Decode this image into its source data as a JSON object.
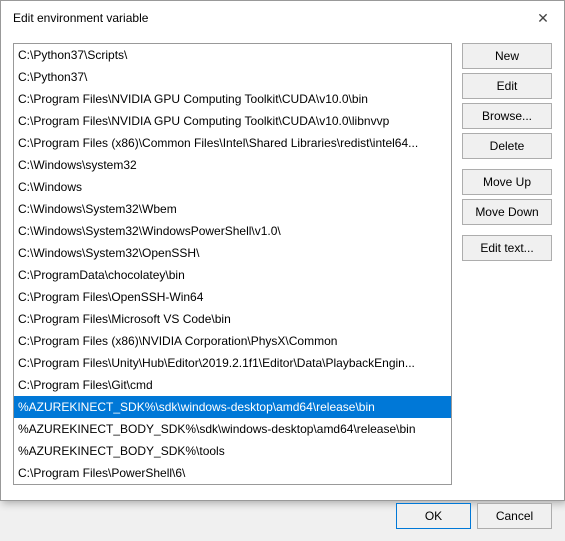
{
  "dialog": {
    "title": "Edit environment variable",
    "close_label": "✕"
  },
  "list": {
    "items": [
      {
        "text": "C:\\Python37\\Scripts\\",
        "selected": false
      },
      {
        "text": "C:\\Python37\\",
        "selected": false
      },
      {
        "text": "C:\\Program Files\\NVIDIA GPU Computing Toolkit\\CUDA\\v10.0\\bin",
        "selected": false
      },
      {
        "text": "C:\\Program Files\\NVIDIA GPU Computing Toolkit\\CUDA\\v10.0\\libnvvp",
        "selected": false
      },
      {
        "text": "C:\\Program Files (x86)\\Common Files\\Intel\\Shared Libraries\\redist\\intel64...",
        "selected": false
      },
      {
        "text": "C:\\Windows\\system32",
        "selected": false
      },
      {
        "text": "C:\\Windows",
        "selected": false
      },
      {
        "text": "C:\\Windows\\System32\\Wbem",
        "selected": false
      },
      {
        "text": "C:\\Windows\\System32\\WindowsPowerShell\\v1.0\\",
        "selected": false
      },
      {
        "text": "C:\\Windows\\System32\\OpenSSH\\",
        "selected": false
      },
      {
        "text": "C:\\ProgramData\\chocolatey\\bin",
        "selected": false
      },
      {
        "text": "C:\\Program Files\\OpenSSH-Win64",
        "selected": false
      },
      {
        "text": "C:\\Program Files\\Microsoft VS Code\\bin",
        "selected": false
      },
      {
        "text": "C:\\Program Files (x86)\\NVIDIA Corporation\\PhysX\\Common",
        "selected": false
      },
      {
        "text": "C:\\Program Files\\Unity\\Hub\\Editor\\2019.2.1f1\\Editor\\Data\\PlaybackEngin...",
        "selected": false
      },
      {
        "text": "C:\\Program Files\\Git\\cmd",
        "selected": false
      },
      {
        "text": "%AZUREKINECT_SDK%\\sdk\\windows-desktop\\amd64\\release\\bin",
        "selected": true
      },
      {
        "text": "%AZUREKINECT_BODY_SDK%\\sdk\\windows-desktop\\amd64\\release\\bin",
        "selected": false
      },
      {
        "text": "%AZUREKINECT_BODY_SDK%\\tools",
        "selected": false
      },
      {
        "text": "C:\\Program Files\\PowerShell\\6\\",
        "selected": false
      }
    ]
  },
  "buttons": {
    "new_label": "New",
    "edit_label": "Edit",
    "browse_label": "Browse...",
    "delete_label": "Delete",
    "move_up_label": "Move Up",
    "move_down_label": "Move Down",
    "edit_text_label": "Edit text..."
  },
  "footer": {
    "ok_label": "OK",
    "cancel_label": "Cancel"
  }
}
